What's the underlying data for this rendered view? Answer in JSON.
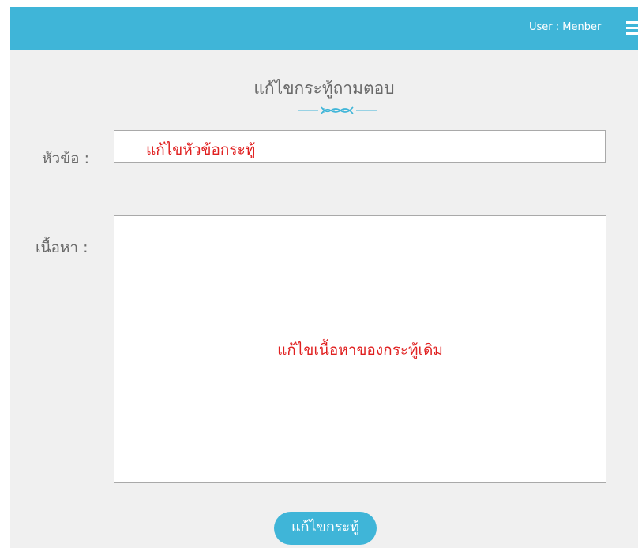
{
  "header": {
    "user_label": "User :  Menber",
    "menu_icon": "hamburger-menu-icon"
  },
  "page": {
    "title": "แก้ไขกระทู้ถามตอบ",
    "ornament_icon": "dna-helix-icon"
  },
  "form": {
    "subject_label": "หัวข้อ :",
    "subject_value": "แก้ไขหัวข้อกระทู้",
    "content_label": "เนื้อหา :",
    "content_value": "แก้ไขเนื้อหาของกระทู้เดิม",
    "submit_label": "แก้ไขกระทู้"
  },
  "colors": {
    "accent": "#3fb5d8",
    "background": "#f0f0f0",
    "placeholder_text": "#e02020",
    "label_text": "#6a6a6a"
  }
}
